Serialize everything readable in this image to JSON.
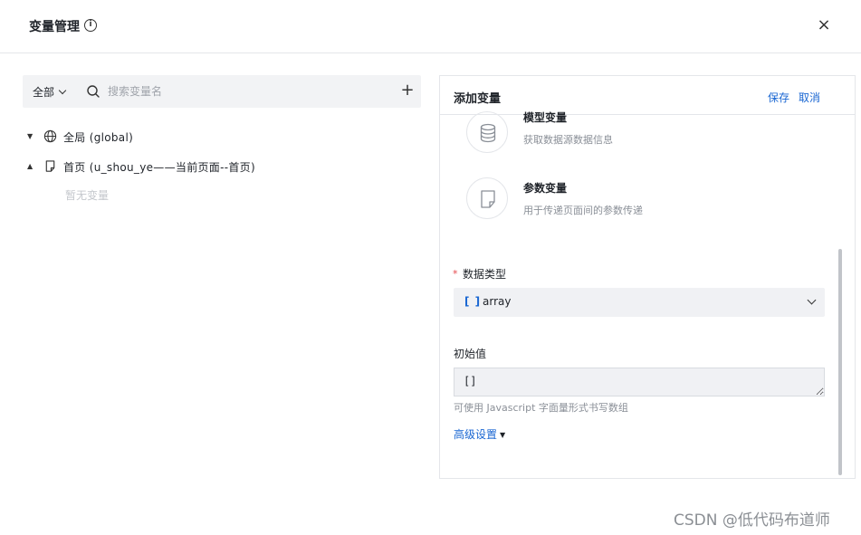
{
  "header": {
    "title": "变量管理",
    "close_label": "×"
  },
  "toolbar": {
    "scope_label": "全部",
    "search_placeholder": "搜索变量名",
    "add_label": "+"
  },
  "tree": {
    "global_label": "全局 (global)",
    "page_label": "首页 (u_shou_ye——当前页面--首页)",
    "empty_text": "暂无变量"
  },
  "panel": {
    "title": "添加变量",
    "save_label": "保存",
    "cancel_label": "取消",
    "types": [
      {
        "name": "模型变量",
        "desc": "获取数据源数据信息",
        "icon": "database-icon"
      },
      {
        "name": "参数变量",
        "desc": "用于传递页面间的参数传递",
        "icon": "document-icon"
      }
    ],
    "data_type": {
      "required_mark": "*",
      "label": "数据类型",
      "value": "array",
      "icon_text": "[ ]"
    },
    "initial_value": {
      "label": "初始值",
      "value": "[]",
      "hint": "可使用 Javascript 字面量形式书写数组"
    },
    "advanced_label": "高级设置"
  },
  "watermark": "CSDN @低代码布道师",
  "colors": {
    "accent": "#1966d2",
    "required": "#e5484d",
    "field_bg": "#f0f1f4"
  }
}
